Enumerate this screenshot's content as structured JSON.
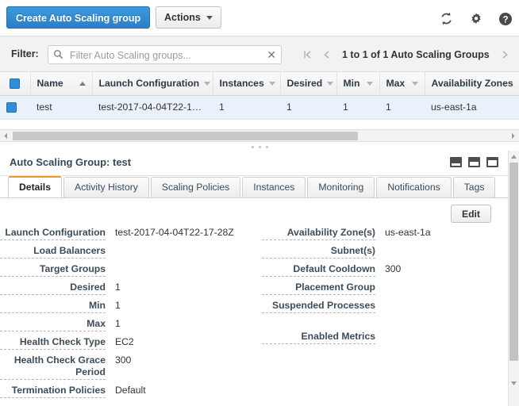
{
  "toolbar": {
    "create_label": "Create Auto Scaling group",
    "actions_label": "Actions",
    "icons": {
      "refresh": "refresh-icon",
      "settings": "gear-icon",
      "help": "help-icon"
    }
  },
  "filterbar": {
    "label": "Filter:",
    "placeholder": "Filter Auto Scaling groups...",
    "value": "",
    "clear_glyph": "✕",
    "pagination": {
      "first_label": "first-page",
      "prev_label": "previous-page",
      "text": "1 to 1 of 1 Auto Scaling Groups",
      "next_label": "next-page"
    }
  },
  "table": {
    "columns": [
      {
        "label": "Name",
        "sort": "asc"
      },
      {
        "label": "Launch Configuration",
        "sort": "none"
      },
      {
        "label": "Instances",
        "sort": "none"
      },
      {
        "label": "Desired",
        "sort": "none"
      },
      {
        "label": "Min",
        "sort": "none"
      },
      {
        "label": "Max",
        "sort": "none"
      },
      {
        "label": "Availability Zones",
        "sort": "none"
      }
    ],
    "rows": [
      {
        "selected": true,
        "name": "test",
        "launch_configuration": "test-2017-04-04T22-17…",
        "instances": "1",
        "desired": "1",
        "min": "1",
        "max": "1",
        "availability_zones": "us-east-1a"
      }
    ]
  },
  "detail": {
    "title": "Auto Scaling Group: test",
    "layout_icons": [
      "layout-small-panel-icon",
      "layout-medium-panel-icon",
      "layout-large-panel-icon"
    ],
    "tabs": [
      {
        "label": "Details",
        "active": true
      },
      {
        "label": "Activity History",
        "active": false
      },
      {
        "label": "Scaling Policies",
        "active": false
      },
      {
        "label": "Instances",
        "active": false
      },
      {
        "label": "Monitoring",
        "active": false
      },
      {
        "label": "Notifications",
        "active": false
      },
      {
        "label": "Tags",
        "active": false
      }
    ],
    "edit_label": "Edit",
    "left_fields": [
      {
        "label": "Launch Configuration",
        "value": "test-2017-04-04T22-17-28Z"
      },
      {
        "label": "Load Balancers",
        "value": ""
      },
      {
        "label": "Target Groups",
        "value": ""
      },
      {
        "label": "Desired",
        "value": "1"
      },
      {
        "label": "Min",
        "value": "1"
      },
      {
        "label": "Max",
        "value": "1"
      },
      {
        "label": "Health Check Type",
        "value": "EC2"
      },
      {
        "label": "Health Check Grace Period",
        "value": "300"
      },
      {
        "label": "Termination Policies",
        "value": "Default"
      }
    ],
    "right_fields": [
      {
        "label": "Availability Zone(s)",
        "value": "us-east-1a"
      },
      {
        "label": "Subnet(s)",
        "value": ""
      },
      {
        "label": "Default Cooldown",
        "value": "300"
      },
      {
        "label": "Placement Group",
        "value": ""
      },
      {
        "label": "Suspended Processes",
        "value": ""
      },
      {
        "label": "Enabled Metrics",
        "value": ""
      }
    ]
  },
  "colors": {
    "primary_button": "#2a80c8",
    "selected_row": "#eaf1fb",
    "active_tab_accent": "#f0992a",
    "checkbox_blue": "#2f8fd8"
  }
}
